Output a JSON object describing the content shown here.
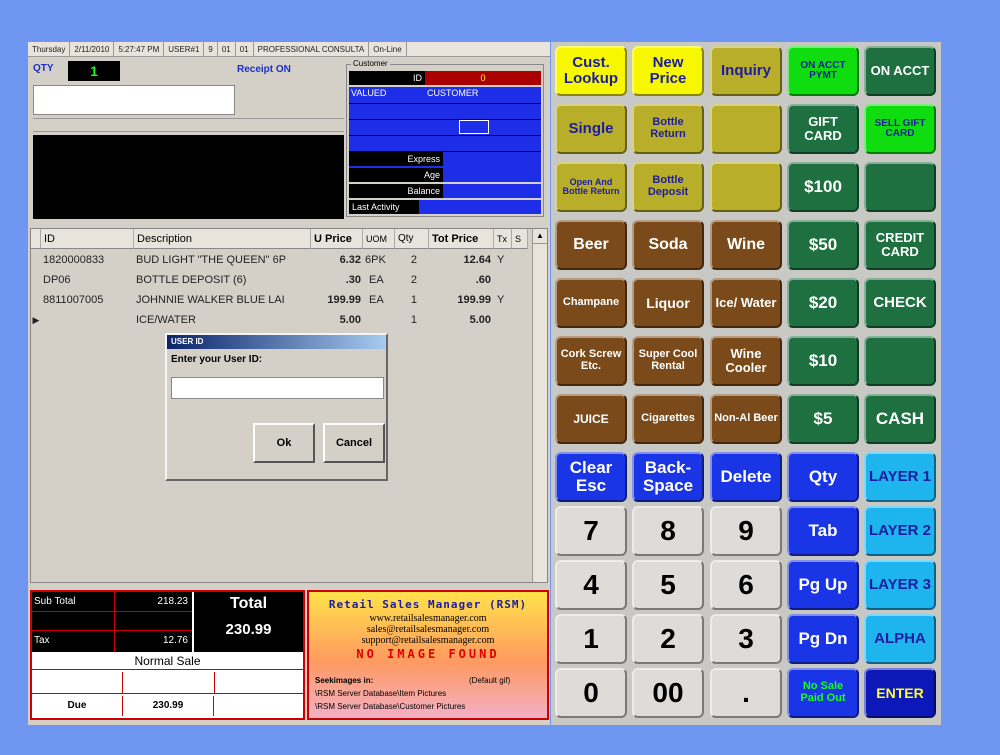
{
  "statusbar": [
    "Thursday",
    "2/11/2010",
    "5:27:47 PM",
    "USER#1",
    "9",
    "01",
    "01",
    "PROFESSIONAL CONSULTA",
    "On-Line"
  ],
  "top": {
    "qty_label": "QTY",
    "qty_value": "1",
    "receipt_label": "Receipt ON"
  },
  "customer": {
    "panel_label": "Customer",
    "id_label": "ID",
    "id_value": "0",
    "name1": "VALUED",
    "name2": "CUSTOMER",
    "express_label": "Express",
    "age_label": "Age",
    "balance_label": "Balance",
    "last_activity_label": "Last Activity"
  },
  "grid": {
    "headers": [
      "ID",
      "Description",
      "U Price",
      "UOM",
      "Qty",
      "Tot Price",
      "Tx",
      "S"
    ],
    "rows": [
      {
        "id": "1820000833",
        "desc": "BUD LIGHT \"THE QUEEN\" 6P",
        "uprice": "6.32",
        "uom": "6PK",
        "qty": "2",
        "tot": "12.64",
        "tx": "Y"
      },
      {
        "id": "DP06",
        "desc": "BOTTLE DEPOSIT (6)",
        "uprice": ".30",
        "uom": "EA",
        "qty": "2",
        "tot": ".60",
        "tx": ""
      },
      {
        "id": "8811007005",
        "desc": "JOHNNIE WALKER BLUE LAI",
        "uprice": "199.99",
        "uom": "EA",
        "qty": "1",
        "tot": "199.99",
        "tx": "Y"
      },
      {
        "id": "",
        "desc": "ICE/WATER",
        "uprice": "5.00",
        "uom": "",
        "qty": "1",
        "tot": "5.00",
        "tx": ""
      }
    ]
  },
  "dialog": {
    "title": "USER ID",
    "prompt": "Enter your User ID:",
    "input_value": "",
    "ok_label": "Ok",
    "cancel_label": "Cancel"
  },
  "totals": {
    "subtotal_label": "Sub Total",
    "subtotal_value": "218.23",
    "tax_label": "Tax",
    "tax_value": "12.76",
    "total_label": "Total",
    "total_value": "230.99",
    "sale_type": "Normal Sale",
    "due_label": "Due",
    "due_value": "230.99"
  },
  "info": {
    "title": "Retail Sales Manager (RSM)",
    "web": "www.retailsalesmanager.com",
    "sales": "sales@retailsalesmanager.com",
    "support": "support@retailsalesmanager.com",
    "no_image": "NO IMAGE FOUND",
    "search_label": "Seekimages in:",
    "default_label": "(Default gif)",
    "path1": "\\RSM Server Database\\Item Pictures",
    "path2": "\\RSM Server Database\\Customer Pictures"
  },
  "keypad": {
    "cust_lookup": "Cust. Lookup",
    "new_price": "New Price",
    "inquiry": "Inquiry",
    "on_acct_pymt": "ON ACCT PYMT",
    "on_acct": "ON ACCT",
    "single": "Single",
    "bottle_return": "Bottle Return",
    "gift_card": "GIFT CARD",
    "sell_gift_card": "SELL GIFT CARD",
    "open_bottle_return": "Open And Bottle Return",
    "bottle_deposit": "Bottle Deposit",
    "d100": "$100",
    "beer": "Beer",
    "soda": "Soda",
    "wine": "Wine",
    "d50": "$50",
    "credit_card": "CREDIT CARD",
    "champane": "Champane",
    "liquor": "Liquor",
    "ice_water": "Ice/ Water",
    "d20": "$20",
    "check": "CHECK",
    "cork_screw": "Cork Screw Etc.",
    "super_cool": "Super Cool Rental",
    "wine_cooler": "Wine Cooler",
    "d10": "$10",
    "juice": "JUICE",
    "cigarettes": "Cigarettes",
    "non_al_beer": "Non-Al Beer",
    "d5": "$5",
    "cash": "CASH",
    "clear_esc": "Clear Esc",
    "backspace": "Back-Space",
    "delete": "Delete",
    "qty": "Qty",
    "layer1": "LAYER 1",
    "n7": "7",
    "n8": "8",
    "n9": "9",
    "tab": "Tab",
    "layer2": "LAYER 2",
    "n4": "4",
    "n5": "5",
    "n6": "6",
    "pgup": "Pg Up",
    "layer3": "LAYER 3",
    "n1": "1",
    "n2": "2",
    "n3": "3",
    "pgdn": "Pg Dn",
    "alpha": "ALPHA",
    "n0": "0",
    "n00": "00",
    "dot": ".",
    "no_sale": "No Sale Paid Out",
    "enter": "ENTER"
  }
}
